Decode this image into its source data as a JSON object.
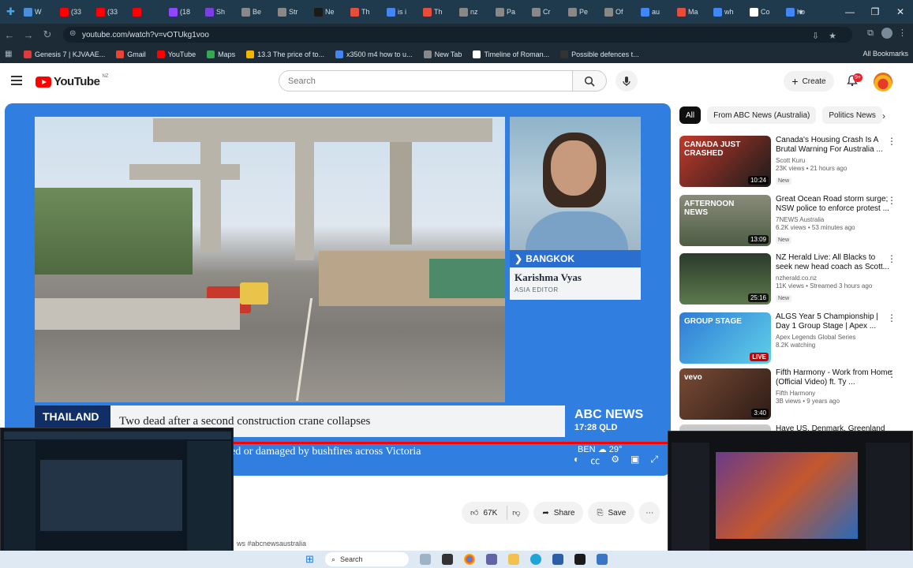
{
  "browser": {
    "tabs": [
      {
        "label": "W",
        "color": "#4a90d9"
      },
      {
        "label": "(33",
        "color": "#ff0000"
      },
      {
        "label": "(33",
        "color": "#ff0000"
      },
      {
        "label": "",
        "color": "#ff0000"
      },
      {
        "label": "(18",
        "color": "#9146ff"
      },
      {
        "label": "Sh",
        "color": "#7b3fe4"
      },
      {
        "label": "Be",
        "color": "#888888"
      },
      {
        "label": "Str",
        "color": "#888888"
      },
      {
        "label": "Ne",
        "color": "#1b1b1b"
      },
      {
        "label": "Th",
        "color": "#e84c3d"
      },
      {
        "label": "is i",
        "color": "#4285f4"
      },
      {
        "label": "Th",
        "color": "#e84c3d"
      },
      {
        "label": "nz",
        "color": "#888888"
      },
      {
        "label": "Pa",
        "color": "#888888"
      },
      {
        "label": "Cr",
        "color": "#888888"
      },
      {
        "label": "Pe",
        "color": "#888888"
      },
      {
        "label": "Of",
        "color": "#888888"
      },
      {
        "label": "au",
        "color": "#4285f4"
      },
      {
        "label": "Ma",
        "color": "#e84c3d"
      },
      {
        "label": "wh",
        "color": "#4285f4"
      },
      {
        "label": "Co",
        "color": "#ffffff"
      },
      {
        "label": "ho",
        "color": "#4285f4"
      }
    ],
    "url": "youtube.com/watch?v=vOTUkg1voo",
    "bookmarks": [
      {
        "label": "Genesis 7 | KJVAAE...",
        "color": "#e03a3a"
      },
      {
        "label": "Gmail",
        "color": "#ea4335"
      },
      {
        "label": "YouTube",
        "color": "#ff0000"
      },
      {
        "label": "Maps",
        "color": "#34a853"
      },
      {
        "label": "13.3 The price of to...",
        "color": "#f4b400"
      },
      {
        "label": "x3500 m4 how to u...",
        "color": "#4285f4"
      },
      {
        "label": "New Tab",
        "color": "#888888"
      },
      {
        "label": "Timeline of Roman...",
        "color": "#ffffff"
      },
      {
        "label": "Possible defences t...",
        "color": "#333333"
      }
    ],
    "all_bookmarks": "All Bookmarks"
  },
  "youtube": {
    "logo_word": "YouTube",
    "country_code": "NZ",
    "search_placeholder": "Search",
    "create_label": "Create",
    "notif_count": "9+"
  },
  "player": {
    "location": "BANGKOK",
    "reporter_name": "Karishma Vyas",
    "reporter_title": "ASIA EDITOR",
    "ticker_country": "THAILAND",
    "headline": "Two dead after a second construction crane collapses",
    "ticker_secondary": "ed or damaged by bushfires across Victoria",
    "brand": "ABC NEWS",
    "time": "17:28 QLD",
    "weather_city": "BEN",
    "weather_temp": "29°",
    "progress_fraction": 1.0
  },
  "actions": {
    "likes": "67K",
    "share": "Share",
    "save": "Save",
    "hashtag": "ws #abcnewsaustralia"
  },
  "chips": [
    "All",
    "From ABC News (Australia)",
    "Politics News"
  ],
  "recommendations": [
    {
      "title": "Canada's Housing Crash Is A Brutal Warning For Australia ...",
      "channel": "Scott Kuru",
      "meta": "23K views • 21 hours ago",
      "badge": "New",
      "duration": "10:24",
      "thumb_bg": "linear-gradient(135deg,#c0392b,#1b1b1b)",
      "thumb_text": "CANADA JUST CRASHED"
    },
    {
      "title": "Great Ocean Road storm surge; NSW police to enforce protest ...",
      "channel": "7NEWS Australia",
      "meta": "6.2K views • 53 minutes ago",
      "badge": "New",
      "duration": "13:09",
      "thumb_bg": "linear-gradient(180deg,#8a8a7a,#4d5e45)",
      "thumb_text": "AFTERNOON NEWS"
    },
    {
      "title": "NZ Herald Live: All Blacks to seek new head coach as Scott...",
      "channel": "nzherald.co.nz",
      "meta": "11K views • Streamed 3 hours ago",
      "badge": "New",
      "duration": "25:16",
      "thumb_bg": "linear-gradient(180deg,#2b3b2a,#5d7a4d)",
      "thumb_text": ""
    },
    {
      "title": "ALGS Year 5 Championship | Day 1 Group Stage | Apex ...",
      "channel": "Apex Legends Global Series",
      "meta": "8.2K watching",
      "badge": "",
      "duration": "LIVE",
      "thumb_bg": "linear-gradient(135deg,#2f7bd6,#5fd0e8)",
      "thumb_text": "GROUP STAGE"
    },
    {
      "title": "Fifth Harmony - Work from Home (Official Video) ft. Ty ...",
      "channel": "Fifth Harmony",
      "meta": "3B views • 9 years ago",
      "badge": "",
      "duration": "3:40",
      "thumb_bg": "linear-gradient(135deg,#7a4a35,#2b1c16)",
      "thumb_text": "vevo"
    },
    {
      "title": "Have US, Denmark, Greenland",
      "channel": "",
      "meta": "",
      "badge": "",
      "duration": "",
      "thumb_bg": "linear-gradient(180deg,#ccc,#999)",
      "thumb_text": ""
    }
  ],
  "taskbar": {
    "search": "Search"
  }
}
